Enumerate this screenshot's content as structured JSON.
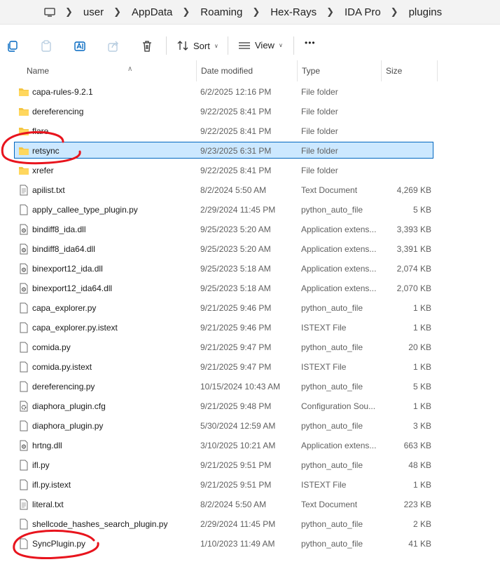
{
  "address": {
    "crumbs": [
      "user",
      "AppData",
      "Roaming",
      "Hex-Rays",
      "IDA Pro",
      "plugins"
    ]
  },
  "toolbar": {
    "sort_label": "Sort",
    "view_label": "View",
    "more_label": "•••"
  },
  "columns": {
    "name": "Name",
    "date": "Date modified",
    "type": "Type",
    "size": "Size"
  },
  "files": [
    {
      "name": "capa-rules-9.2.1",
      "date": "6/2/2025 12:16 PM",
      "type": "File folder",
      "size": "",
      "icon": "folder-icon"
    },
    {
      "name": "dereferencing",
      "date": "9/22/2025 8:41 PM",
      "type": "File folder",
      "size": "",
      "icon": "folder-icon"
    },
    {
      "name": "flare",
      "date": "9/22/2025 8:41 PM",
      "type": "File folder",
      "size": "",
      "icon": "folder-icon"
    },
    {
      "name": "retsync",
      "date": "9/23/2025 6:31 PM",
      "type": "File folder",
      "size": "",
      "icon": "folder-icon"
    },
    {
      "name": "xrefer",
      "date": "9/22/2025 8:41 PM",
      "type": "File folder",
      "size": "",
      "icon": "folder-icon"
    },
    {
      "name": "apilist.txt",
      "date": "8/2/2024 5:50 AM",
      "type": "Text Document",
      "size": "4,269 KB",
      "icon": "text-file-icon"
    },
    {
      "name": "apply_callee_type_plugin.py",
      "date": "2/29/2024 11:45 PM",
      "type": "python_auto_file",
      "size": "5 KB",
      "icon": "file-icon"
    },
    {
      "name": "bindiff8_ida.dll",
      "date": "9/25/2023 5:20 AM",
      "type": "Application extens...",
      "size": "3,393 KB",
      "icon": "dll-file-icon"
    },
    {
      "name": "bindiff8_ida64.dll",
      "date": "9/25/2023 5:20 AM",
      "type": "Application extens...",
      "size": "3,391 KB",
      "icon": "dll-file-icon"
    },
    {
      "name": "binexport12_ida.dll",
      "date": "9/25/2023 5:18 AM",
      "type": "Application extens...",
      "size": "2,074 KB",
      "icon": "dll-file-icon"
    },
    {
      "name": "binexport12_ida64.dll",
      "date": "9/25/2023 5:18 AM",
      "type": "Application extens...",
      "size": "2,070 KB",
      "icon": "dll-file-icon"
    },
    {
      "name": "capa_explorer.py",
      "date": "9/21/2025 9:46 PM",
      "type": "python_auto_file",
      "size": "1 KB",
      "icon": "file-icon"
    },
    {
      "name": "capa_explorer.py.istext",
      "date": "9/21/2025 9:46 PM",
      "type": "ISTEXT File",
      "size": "1 KB",
      "icon": "file-icon"
    },
    {
      "name": "comida.py",
      "date": "9/21/2025 9:47 PM",
      "type": "python_auto_file",
      "size": "20 KB",
      "icon": "file-icon"
    },
    {
      "name": "comida.py.istext",
      "date": "9/21/2025 9:47 PM",
      "type": "ISTEXT File",
      "size": "1 KB",
      "icon": "file-icon"
    },
    {
      "name": "dereferencing.py",
      "date": "10/15/2024 10:43 AM",
      "type": "python_auto_file",
      "size": "5 KB",
      "icon": "file-icon"
    },
    {
      "name": "diaphora_plugin.cfg",
      "date": "9/21/2025 9:48 PM",
      "type": "Configuration Sou...",
      "size": "1 KB",
      "icon": "config-file-icon"
    },
    {
      "name": "diaphora_plugin.py",
      "date": "5/30/2024 12:59 AM",
      "type": "python_auto_file",
      "size": "3 KB",
      "icon": "file-icon"
    },
    {
      "name": "hrtng.dll",
      "date": "3/10/2025 10:21 AM",
      "type": "Application extens...",
      "size": "663 KB",
      "icon": "dll-file-icon"
    },
    {
      "name": "ifl.py",
      "date": "9/21/2025 9:51 PM",
      "type": "python_auto_file",
      "size": "48 KB",
      "icon": "file-icon"
    },
    {
      "name": "ifl.py.istext",
      "date": "9/21/2025 9:51 PM",
      "type": "ISTEXT File",
      "size": "1 KB",
      "icon": "file-icon"
    },
    {
      "name": "literal.txt",
      "date": "8/2/2024 5:50 AM",
      "type": "Text Document",
      "size": "223 KB",
      "icon": "text-file-icon"
    },
    {
      "name": "shellcode_hashes_search_plugin.py",
      "date": "2/29/2024 11:45 PM",
      "type": "python_auto_file",
      "size": "2 KB",
      "icon": "file-icon"
    },
    {
      "name": "SyncPlugin.py",
      "date": "1/10/2023 11:49 AM",
      "type": "python_auto_file",
      "size": "41 KB",
      "icon": "file-icon"
    }
  ],
  "selected_index": 3,
  "colors": {
    "selection_fill": "#cce8ff",
    "selection_border": "#0067c0",
    "folder": "#f4c542",
    "annotation": "#e8141d"
  }
}
